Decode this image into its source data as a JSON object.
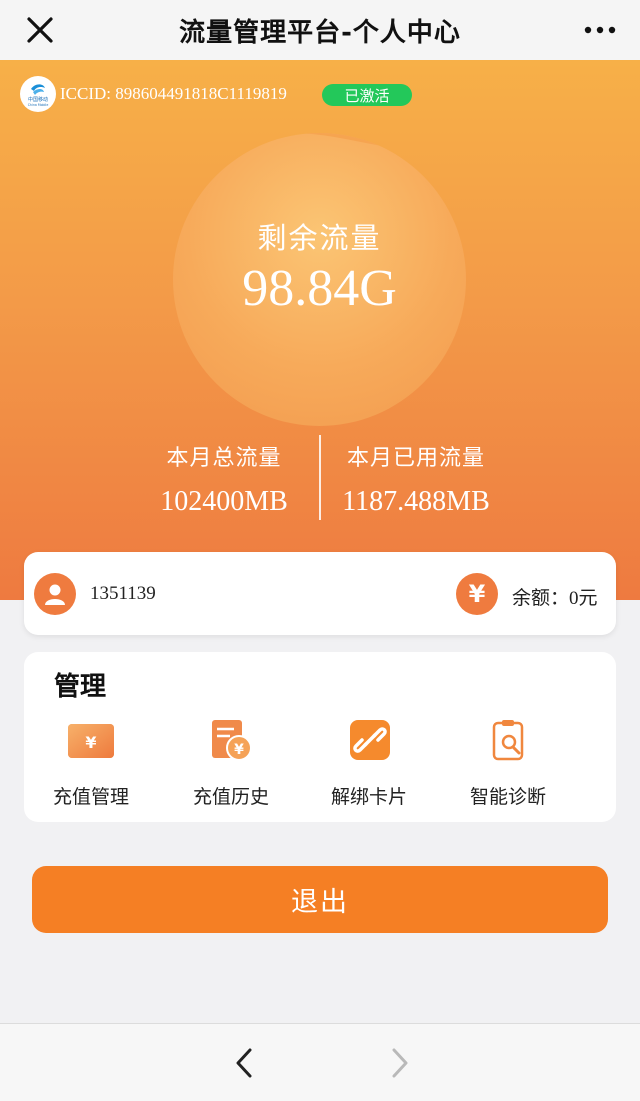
{
  "titlebar": {
    "title": "流量管理平台-个人中心"
  },
  "header": {
    "iccid": "ICCID: 898604491818C1119819",
    "status": "已激活",
    "logo_icon": "china-mobile-logo",
    "logo_text": "中国移动"
  },
  "usage": {
    "remaining_label": "剩余流量",
    "remaining_value": "98.84G",
    "total_label": "本月总流量",
    "total_value": "102400MB",
    "used_label": "本月已用流量",
    "used_value": "1187.488MB"
  },
  "account": {
    "phone": "1351139",
    "balance_label": "余额：",
    "balance_value": "0元",
    "yen_symbol": "¥"
  },
  "manage": {
    "title": "管理",
    "items": [
      {
        "label": "充值管理",
        "icon": "recharge-card-icon"
      },
      {
        "label": "充值历史",
        "icon": "recharge-history-icon"
      },
      {
        "label": "解绑卡片",
        "icon": "unbind-link-icon"
      },
      {
        "label": "智能诊断",
        "icon": "diagnosis-icon"
      }
    ]
  },
  "logout_label": "退出",
  "colors": {
    "accent": "#f57f24",
    "badge": "#23c85a",
    "hero_top": "#f7b048",
    "hero_bottom": "#ee7a40"
  }
}
